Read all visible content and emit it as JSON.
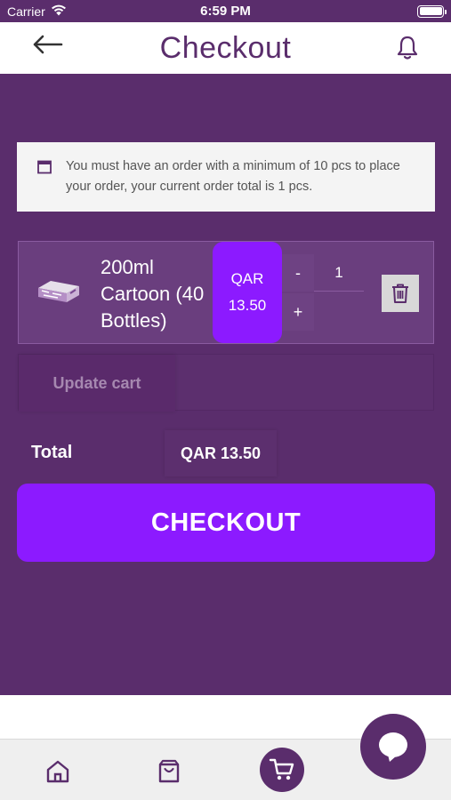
{
  "status_bar": {
    "carrier": "Carrier",
    "time": "6:59 PM"
  },
  "header": {
    "title": "Checkout",
    "back_icon": "arrow-left-icon",
    "bell_icon": "bell-icon"
  },
  "notice": {
    "icon": "calendar-icon",
    "text": "You must have an order with a minimum of 10 pcs to place your order, your current order total is 1 pcs."
  },
  "cart": {
    "items": [
      {
        "name": "200ml Cartoon (40 Bottles)",
        "currency": "QAR",
        "price": "13.50",
        "quantity": "1",
        "minus_label": "-",
        "plus_label": "+"
      }
    ],
    "update_label": "Update cart"
  },
  "total": {
    "label": "Total",
    "value": "QAR 13.50"
  },
  "checkout_label": "CHECKOUT",
  "tabs": [
    {
      "icon": "home-icon"
    },
    {
      "icon": "shopping-bag-icon"
    },
    {
      "icon": "cart-icon",
      "active": true
    }
  ],
  "colors": {
    "primary": "#5a2d6c",
    "accent": "#8c1aff",
    "white": "#ffffff"
  }
}
